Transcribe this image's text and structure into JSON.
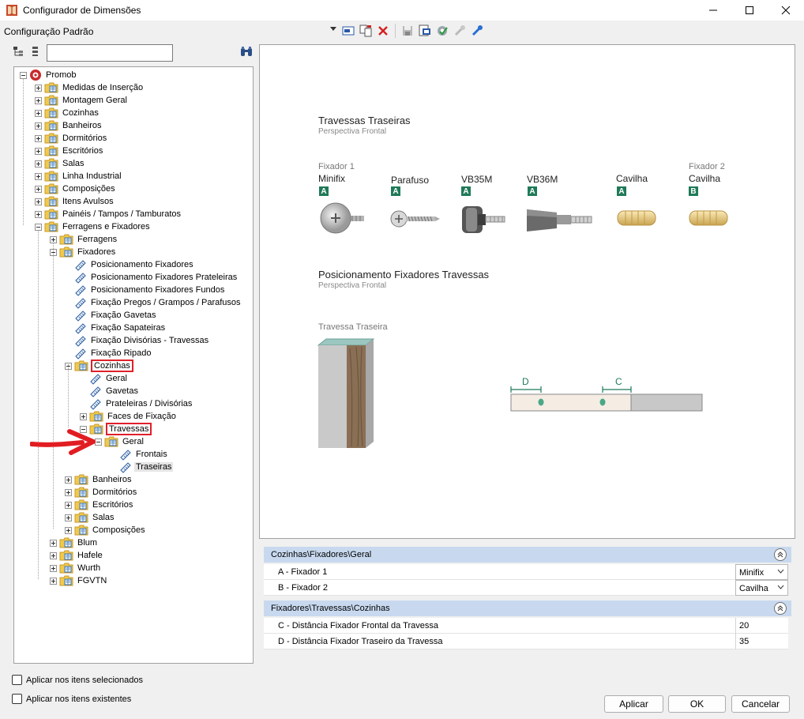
{
  "window": {
    "title": "Configurador de Dimensões"
  },
  "config": {
    "name": "Configuração Padrão"
  },
  "tree": {
    "search_value": "",
    "root": "Promob",
    "level1": [
      "Medidas de Inserção",
      "Montagem Geral",
      "Cozinhas",
      "Banheiros",
      "Dormitórios",
      "Escritórios",
      "Salas",
      "Linha Industrial",
      "Composições",
      "Itens Avulsos",
      "Painéis / Tampos / Tamburatos",
      "Ferragens e Fixadores"
    ],
    "level2_top": [
      "Ferragens",
      "Fixadores"
    ],
    "fixadores_children": [
      "Posicionamento Fixadores",
      "Posicionamento Fixadores Prateleiras",
      "Posicionamento Fixadores Fundos",
      "Fixação Pregos / Grampos / Parafusos",
      "Fixação Gavetas",
      "Fixação Sapateiras",
      "Fixação Divisórias - Travessas",
      "Fixação Ripado"
    ],
    "cozinhas": "Cozinhas",
    "cozinhas_children": [
      "Geral",
      "Gavetas",
      "Prateleiras / Divisórias"
    ],
    "faces": "Faces de Fixação",
    "travessas": "Travessas",
    "geral": "Geral",
    "geral_children": [
      "Frontais",
      "Traseiras"
    ],
    "level3_rest": [
      "Banheiros",
      "Dormitórios",
      "Escritórios",
      "Salas",
      "Composições"
    ],
    "level2_rest": [
      "Blum",
      "Hafele",
      "Wurth",
      "FGVTN"
    ]
  },
  "preview": {
    "section1_title": "Travessas Traseiras",
    "section1_sub": "Perspectiva Frontal",
    "fixers": [
      {
        "top": "Fixador 1",
        "name": "Minifix",
        "badge": "A"
      },
      {
        "top": "",
        "name": "Parafuso",
        "badge": "A"
      },
      {
        "top": "",
        "name": "VB35M",
        "badge": "A"
      },
      {
        "top": "",
        "name": "VB36M",
        "badge": "A"
      },
      {
        "top": "",
        "name": "Cavilha",
        "badge": "A"
      },
      {
        "top": "Fixador 2",
        "name": "Cavilha",
        "badge": "B"
      }
    ],
    "section2_title": "Posicionamento Fixadores Travessas",
    "section2_sub": "Perspectiva Frontal",
    "piece_label": "Travessa Traseira",
    "dim_d": "D",
    "dim_c": "C"
  },
  "groups": [
    {
      "title": "Cozinhas\\Fixadores\\Geral",
      "rows": [
        {
          "name": "A - Fixador 1",
          "value": "Minifix"
        },
        {
          "name": "B - Fixador 2",
          "value": "Cavilha"
        }
      ]
    },
    {
      "title": "Fixadores\\Travessas\\Cozinhas",
      "rows": [
        {
          "name": "C - Distância Fixador Frontal da Travessa",
          "value": "20"
        },
        {
          "name": "D - Distância Fixador Traseiro da Travessa",
          "value": "35"
        }
      ]
    }
  ],
  "options": {
    "apply_selected": "Aplicar nos itens selecionados",
    "apply_existing": "Aplicar nos itens existentes"
  },
  "buttons": {
    "apply": "Aplicar",
    "ok": "OK",
    "cancel": "Cancelar"
  }
}
